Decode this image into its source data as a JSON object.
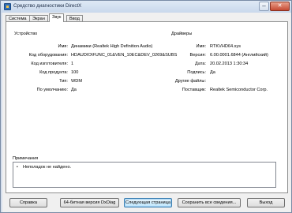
{
  "window": {
    "title": "Средство диагностики DirectX",
    "minimize_label": "–",
    "close_label": "✕"
  },
  "tabs": [
    {
      "label": "Система",
      "active": false
    },
    {
      "label": "Экран",
      "active": false
    },
    {
      "label": "Звук",
      "active": true
    },
    {
      "label": "Ввод",
      "active": false
    }
  ],
  "device": {
    "title": "Устройство",
    "rows": [
      {
        "label": "Имя:",
        "value": "Динамики (Realtek High Definition Audio)"
      },
      {
        "label": "Код оборудования:",
        "value": "HDAUDIO\\FUNC_01&VEN_10EC&DEV_0269&SUBS"
      },
      {
        "label": "Код изготовителя:",
        "value": "1"
      },
      {
        "label": "Код продукта:",
        "value": "100"
      },
      {
        "label": "Тип:",
        "value": "WDM"
      },
      {
        "label": "По умолчанию:",
        "value": "Да"
      }
    ]
  },
  "drivers": {
    "title": "Драйверы",
    "rows": [
      {
        "label": "Имя:",
        "value": "RTKVHD64.sys"
      },
      {
        "label": "Версия:",
        "value": "6.00.0001.6844 (Английский)"
      },
      {
        "label": "Дата:",
        "value": "20.02.2013 1:30:34"
      },
      {
        "label": "Подпись:",
        "value": "Да"
      },
      {
        "label": "Другие файлы:",
        "value": ""
      },
      {
        "label": "Поставщик:",
        "value": "Realtek Semiconductor Corp."
      }
    ]
  },
  "notes": {
    "title": "Примечания",
    "bullet": "•",
    "text": "Неполадок не найдено."
  },
  "buttons": {
    "help": "Справка",
    "dxdiag64": "64-битная версия DxDiag",
    "next_page": "Следующая страница",
    "save_all": "Сохранить все сведения...",
    "exit": "Выход"
  }
}
